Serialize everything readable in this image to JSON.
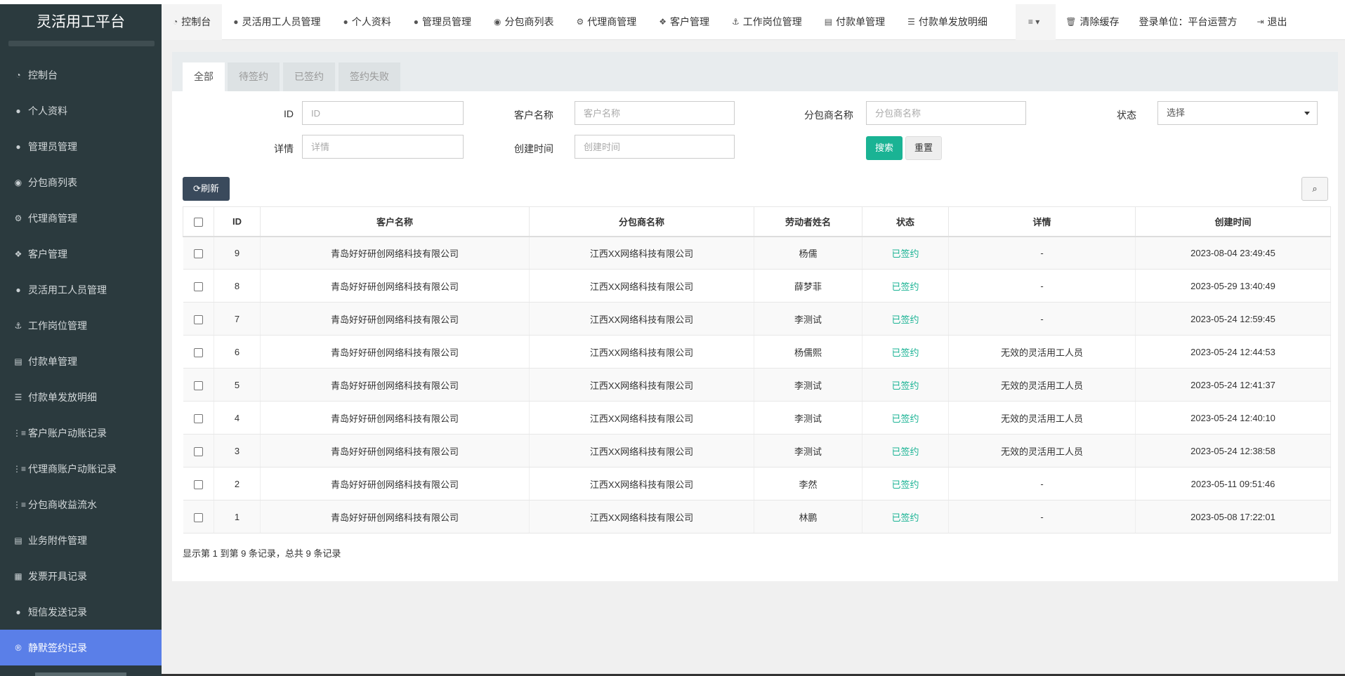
{
  "app": {
    "title": "灵活用工平台"
  },
  "sidebar": {
    "items": [
      {
        "label": "控制台",
        "icon": "dashboard-icon",
        "glyph": "◔"
      },
      {
        "label": "个人资料",
        "icon": "user-icon",
        "glyph": "●"
      },
      {
        "label": "管理员管理",
        "icon": "user-icon",
        "glyph": "●"
      },
      {
        "label": "分包商列表",
        "icon": "globe-icon",
        "glyph": "◉"
      },
      {
        "label": "代理商管理",
        "icon": "cogs-icon",
        "glyph": "⚙"
      },
      {
        "label": "客户管理",
        "icon": "cubes-icon",
        "glyph": "❖"
      },
      {
        "label": "灵活用工人员管理",
        "icon": "user-icon",
        "glyph": "●"
      },
      {
        "label": "工作岗位管理",
        "icon": "anchor-icon",
        "glyph": "⚓"
      },
      {
        "label": "付款单管理",
        "icon": "file-icon",
        "glyph": "▤"
      },
      {
        "label": "付款单发放明细",
        "icon": "list-icon",
        "glyph": "☰"
      },
      {
        "label": "客户账户动账记录",
        "icon": "list-ol-icon",
        "glyph": "⋮≡"
      },
      {
        "label": "代理商账户动账记录",
        "icon": "list-ol-icon",
        "glyph": "⋮≡"
      },
      {
        "label": "分包商收益流水",
        "icon": "list-ol-icon",
        "glyph": "⋮≡"
      },
      {
        "label": "业务附件管理",
        "icon": "file-icon",
        "glyph": "▤"
      },
      {
        "label": "发票开具记录",
        "icon": "calculator-icon",
        "glyph": "▦"
      },
      {
        "label": "短信发送记录",
        "icon": "comment-icon",
        "glyph": "●"
      },
      {
        "label": "静默签约记录",
        "icon": "registered-icon",
        "glyph": "®"
      }
    ]
  },
  "topnav": {
    "items": [
      {
        "label": "控制台",
        "icon": "dashboard-icon",
        "glyph": "◔"
      },
      {
        "label": "灵活用工人员管理",
        "icon": "user-icon",
        "glyph": "●"
      },
      {
        "label": "个人资料",
        "icon": "user-icon",
        "glyph": "●"
      },
      {
        "label": "管理员管理",
        "icon": "user-icon",
        "glyph": "●"
      },
      {
        "label": "分包商列表",
        "icon": "globe-icon",
        "glyph": "◉"
      },
      {
        "label": "代理商管理",
        "icon": "cogs-icon",
        "glyph": "⚙"
      },
      {
        "label": "客户管理",
        "icon": "cubes-icon",
        "glyph": "❖"
      },
      {
        "label": "工作岗位管理",
        "icon": "anchor-icon",
        "glyph": "⚓"
      },
      {
        "label": "付款单管理",
        "icon": "file-icon",
        "glyph": "▤"
      },
      {
        "label": "付款单发放明细",
        "icon": "list-icon",
        "glyph": "☰"
      }
    ],
    "menu_glyph": "≡ ▾",
    "clear_cache": "清除缓存",
    "clear_cache_glyph": "🗑",
    "login_unit": "登录单位：平台运营方",
    "logout": "退出",
    "logout_glyph": "⇥"
  },
  "tabs": [
    {
      "label": "全部"
    },
    {
      "label": "待签约"
    },
    {
      "label": "已签约"
    },
    {
      "label": "签约失败"
    }
  ],
  "filters": {
    "id_label": "ID",
    "id_placeholder": "ID",
    "customer_label": "客户名称",
    "customer_placeholder": "客户名称",
    "sub_label": "分包商名称",
    "sub_placeholder": "分包商名称",
    "status_label": "状态",
    "status_value": "选择",
    "detail_label": "详情",
    "detail_placeholder": "详情",
    "created_label": "创建时间",
    "created_placeholder": "创建时间",
    "search_button": "搜索",
    "reset_button": "重置"
  },
  "toolbar": {
    "refresh": "刷新",
    "refresh_glyph": "⟳",
    "search_toggle_glyph": "⌕"
  },
  "table": {
    "columns": [
      "ID",
      "客户名称",
      "分包商名称",
      "劳动者姓名",
      "状态",
      "详情",
      "创建时间"
    ],
    "rows": [
      [
        "9",
        "青岛好好研创网络科技有限公司",
        "江西XX网络科技有限公司",
        "杨儒",
        "已签约",
        "-",
        "2023-08-04 23:49:45"
      ],
      [
        "8",
        "青岛好好研创网络科技有限公司",
        "江西XX网络科技有限公司",
        "薛梦菲",
        "已签约",
        "-",
        "2023-05-29 13:40:49"
      ],
      [
        "7",
        "青岛好好研创网络科技有限公司",
        "江西XX网络科技有限公司",
        "李测试",
        "已签约",
        "-",
        "2023-05-24 12:59:45"
      ],
      [
        "6",
        "青岛好好研创网络科技有限公司",
        "江西XX网络科技有限公司",
        "杨儒熙",
        "已签约",
        "无效的灵活用工人员",
        "2023-05-24 12:44:53"
      ],
      [
        "5",
        "青岛好好研创网络科技有限公司",
        "江西XX网络科技有限公司",
        "李测试",
        "已签约",
        "无效的灵活用工人员",
        "2023-05-24 12:41:37"
      ],
      [
        "4",
        "青岛好好研创网络科技有限公司",
        "江西XX网络科技有限公司",
        "李测试",
        "已签约",
        "无效的灵活用工人员",
        "2023-05-24 12:40:10"
      ],
      [
        "3",
        "青岛好好研创网络科技有限公司",
        "江西XX网络科技有限公司",
        "李测试",
        "已签约",
        "无效的灵活用工人员",
        "2023-05-24 12:38:58"
      ],
      [
        "2",
        "青岛好好研创网络科技有限公司",
        "江西XX网络科技有限公司",
        "李然",
        "已签约",
        "-",
        "2023-05-11 09:51:46"
      ],
      [
        "1",
        "青岛好好研创网络科技有限公司",
        "江西XX网络科技有限公司",
        "林鹏",
        "已签约",
        "-",
        "2023-05-08 17:22:01"
      ]
    ]
  },
  "pagination": {
    "summary": "显示第 1 到第 9 条记录，总共 9 条记录"
  },
  "colors": {
    "active_nav": "#5a7fe8",
    "sidebar_bg": "#2b3a3e",
    "success": "#1ab394",
    "refresh_btn": "#3a4a5c"
  }
}
